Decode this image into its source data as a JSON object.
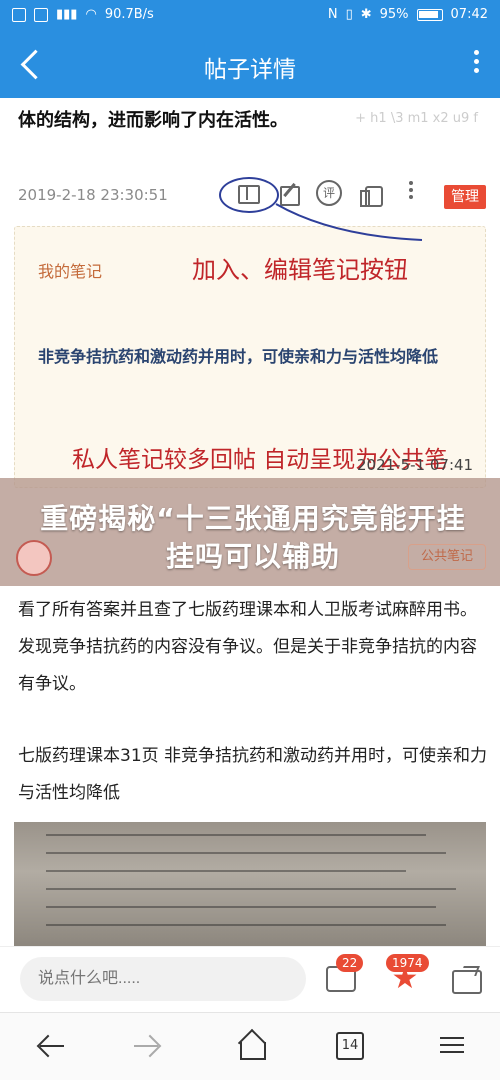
{
  "status": {
    "speed": "90.7B/s",
    "battery": "95%",
    "time": "07:42"
  },
  "header": {
    "title": "帖子详情"
  },
  "post": {
    "prev_text": "体的结构，进而影响了内在活性。",
    "prev_text_right": "+ h1 \\3 m1 x2 u9 f",
    "timestamp": "2019-2-18 23:30:51",
    "comment_icon_text": "评",
    "manage_label": "管理"
  },
  "note": {
    "title": "我的笔记",
    "annotation_buttons": "加入、编辑笔记按钮",
    "body": "非竞争拮抗药和激动药并用时，可使亲和力与活性均降低",
    "annotation_public": "私人笔记较多回帖 自动呈现为公共笔",
    "date": "2021-5-1 07:41"
  },
  "overlay": {
    "text": "重磅揭秘“十三张通用究竟能开挂挂吗可以辅助"
  },
  "reply": {
    "public_note_label": "公共笔记",
    "answer_p1": "看了所有答案并且查了七版药理课本和人卫版考试麻醉用书。发现竞争拮抗药的内容没有争议。但是关于非竞争拮抗的内容有争议。",
    "answer_p2": "七版药理课本31页 非竞争拮抗药和激动药并用时，可使亲和力与活性均降低"
  },
  "bottom": {
    "comment_placeholder": "说点什么吧.....",
    "comment_count": "22",
    "favorite_count": "1974"
  },
  "nav": {
    "tabs_count": "14"
  },
  "colors": {
    "primary": "#2a8fe0",
    "accent_red": "#e94b35",
    "note_bg": "#fdf8ed"
  }
}
